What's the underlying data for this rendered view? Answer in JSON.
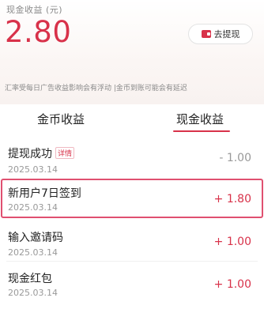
{
  "header": {
    "cash_title": "现金收益 (元)",
    "cash_amount": "2.80",
    "withdraw_label": "去提现",
    "notice": "汇率受每日广告收益影响会有浮动 |金币到账可能会有延迟"
  },
  "tabs": [
    {
      "label": "金币收益",
      "active": false
    },
    {
      "label": "现金收益",
      "active": true
    }
  ],
  "records": [
    {
      "title": "提现成功",
      "tag": "详情",
      "date": "2025.03.14",
      "amount": "- 1.00",
      "amount_color": "#999999"
    },
    {
      "title": "新用户7日签到",
      "tag": "",
      "date": "2025.03.14",
      "amount": "+ 1.80",
      "amount_color": "#d8324a"
    },
    {
      "title": "输入邀请码",
      "tag": "",
      "date": "2025.03.14",
      "amount": "+ 1.00",
      "amount_color": "#d8324a"
    },
    {
      "title": "现金红包",
      "tag": "",
      "date": "2025.03.14",
      "amount": "+ 1.00",
      "amount_color": "#d8324a"
    }
  ],
  "colors": {
    "accent": "#d8324a",
    "highlight_border": "#e05070"
  }
}
